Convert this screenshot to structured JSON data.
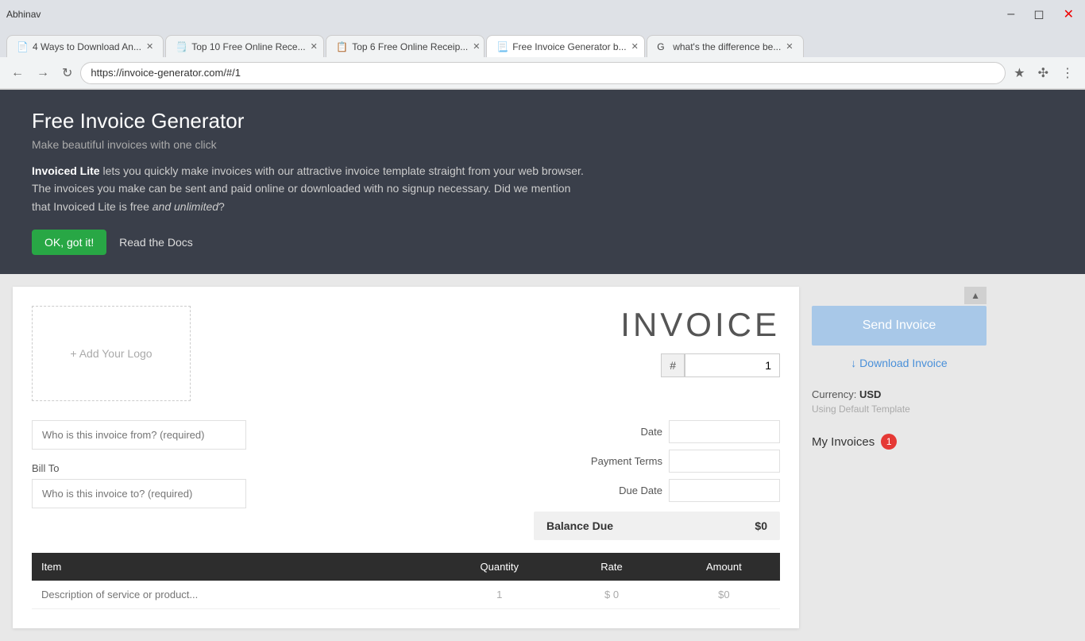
{
  "browser": {
    "tabs": [
      {
        "id": "tab1",
        "title": "4 Ways to Download An...",
        "favicon": "📄",
        "active": false
      },
      {
        "id": "tab2",
        "title": "Top 10 Free Online Rece...",
        "favicon": "🗒️",
        "active": false
      },
      {
        "id": "tab3",
        "title": "Top 6 Free Online Receip...",
        "favicon": "📋",
        "active": false
      },
      {
        "id": "tab4",
        "title": "Free Invoice Generator b...",
        "favicon": "📃",
        "active": true
      },
      {
        "id": "tab5",
        "title": "what's the difference be...",
        "favicon": "G",
        "active": false
      }
    ],
    "user": "Abhinav",
    "url": "https://invoice-generator.com/#/1"
  },
  "banner": {
    "title": "Free Invoice Generator",
    "subtitle": "Make beautiful invoices with one click",
    "description_pre": " lets you quickly make invoices with our attractive invoice template straight from your web browser. The invoices you make can be sent and paid online or downloaded with no signup necessary. Did we mention that Invoiced Lite is free ",
    "brand": "Invoiced Lite",
    "italic_part": "and unlimited",
    "description_post": "?",
    "ok_button": "OK, got it!",
    "docs_button": "Read the Docs"
  },
  "invoice": {
    "title": "INVOICE",
    "hash_symbol": "#",
    "number": "1",
    "logo_placeholder": "+ Add Your Logo",
    "from_placeholder": "Who is this invoice from? (required)",
    "bill_to_label": "Bill To",
    "bill_to_placeholder": "Who is this invoice to? (required)",
    "date_label": "Date",
    "payment_terms_label": "Payment Terms",
    "due_date_label": "Due Date",
    "balance_due_label": "Balance Due",
    "balance_due_value": "$0",
    "items_table": {
      "columns": [
        "Item",
        "Quantity",
        "Rate",
        "Amount"
      ],
      "row_placeholder": "Description of service or product...",
      "quantity_default": "1",
      "rate_prefix": "$",
      "rate_default": "0",
      "amount_prefix": "$",
      "amount_default": "0"
    }
  },
  "sidebar": {
    "send_invoice_label": "Send Invoice",
    "download_invoice_label": "↓ Download Invoice",
    "currency_label": "Currency:",
    "currency_value": "USD",
    "using_template_label": "Using Default Template",
    "my_invoices_label": "My Invoices",
    "my_invoices_count": "1"
  }
}
